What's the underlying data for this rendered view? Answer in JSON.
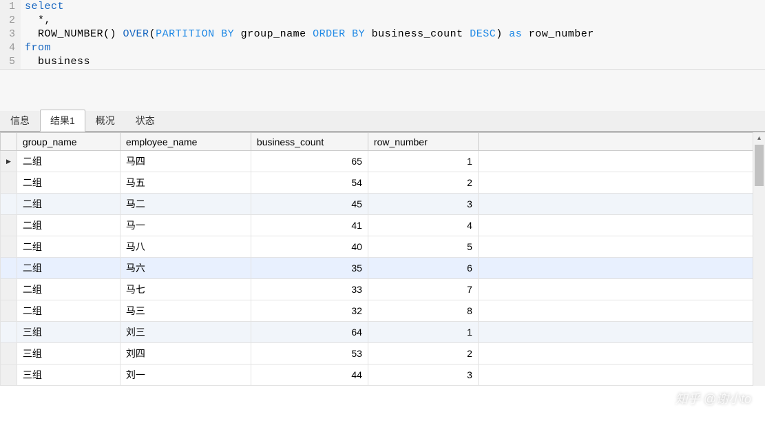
{
  "editor": {
    "lines": [
      {
        "n": "1",
        "tokens": [
          {
            "t": "select",
            "c": "kw"
          }
        ]
      },
      {
        "n": "2",
        "tokens": [
          {
            "t": "  *,",
            "c": "ident"
          }
        ]
      },
      {
        "n": "3",
        "tokens": [
          {
            "t": "  ROW_NUMBER",
            "c": "ident"
          },
          {
            "t": "() ",
            "c": "ident"
          },
          {
            "t": "OVER",
            "c": "kw"
          },
          {
            "t": "(",
            "c": "ident"
          },
          {
            "t": "PARTITION BY",
            "c": "kw2"
          },
          {
            "t": " group_name ",
            "c": "ident"
          },
          {
            "t": "ORDER BY",
            "c": "kw2"
          },
          {
            "t": " business_count ",
            "c": "ident"
          },
          {
            "t": "DESC",
            "c": "kw2"
          },
          {
            "t": ") ",
            "c": "ident"
          },
          {
            "t": "as",
            "c": "kw2"
          },
          {
            "t": " row_number",
            "c": "ident"
          }
        ]
      },
      {
        "n": "4",
        "tokens": [
          {
            "t": "from",
            "c": "kw"
          }
        ]
      },
      {
        "n": "5",
        "tokens": [
          {
            "t": "  business",
            "c": "ident"
          }
        ]
      }
    ]
  },
  "tabs": {
    "items": [
      {
        "label": "信息",
        "active": false
      },
      {
        "label": "结果1",
        "active": true
      },
      {
        "label": "概况",
        "active": false
      },
      {
        "label": "状态",
        "active": false
      }
    ]
  },
  "grid": {
    "headers": [
      "group_name",
      "employee_name",
      "business_count",
      "row_number"
    ],
    "rows": [
      {
        "group_name": "二组",
        "employee_name": "马四",
        "business_count": "65",
        "row_number": "1",
        "current": true
      },
      {
        "group_name": "二组",
        "employee_name": "马五",
        "business_count": "54",
        "row_number": "2"
      },
      {
        "group_name": "二组",
        "employee_name": "马二",
        "business_count": "45",
        "row_number": "3",
        "alt": true
      },
      {
        "group_name": "二组",
        "employee_name": "马一",
        "business_count": "41",
        "row_number": "4"
      },
      {
        "group_name": "二组",
        "employee_name": "马八",
        "business_count": "40",
        "row_number": "5"
      },
      {
        "group_name": "二组",
        "employee_name": "马六",
        "business_count": "35",
        "row_number": "6",
        "highlight": true
      },
      {
        "group_name": "二组",
        "employee_name": "马七",
        "business_count": "33",
        "row_number": "7"
      },
      {
        "group_name": "二组",
        "employee_name": "马三",
        "business_count": "32",
        "row_number": "8"
      },
      {
        "group_name": "三组",
        "employee_name": "刘三",
        "business_count": "64",
        "row_number": "1",
        "alt": true
      },
      {
        "group_name": "三组",
        "employee_name": "刘四",
        "business_count": "53",
        "row_number": "2"
      },
      {
        "group_name": "三组",
        "employee_name": "刘一",
        "business_count": "44",
        "row_number": "3"
      }
    ]
  },
  "watermark": "知乎 @谢小to"
}
